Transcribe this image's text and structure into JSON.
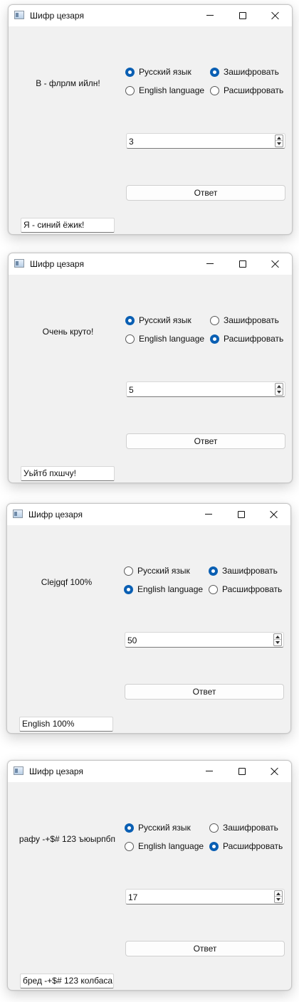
{
  "windows": [
    {
      "title": "Шифр цезаря",
      "output": "В - флрлм ийлн!",
      "lang_options": [
        {
          "label": "Русский язык",
          "selected": true
        },
        {
          "label": "English language",
          "selected": false
        }
      ],
      "mode_options": [
        {
          "label": "Зашифровать",
          "selected": true
        },
        {
          "label": "Расшифровать",
          "selected": false
        }
      ],
      "shift": "3",
      "answer_button": "Ответ",
      "input": "Я - синий ёжик!"
    },
    {
      "title": "Шифр цезаря",
      "output": "Очень круто!",
      "lang_options": [
        {
          "label": "Русский язык",
          "selected": true
        },
        {
          "label": "English language",
          "selected": false
        }
      ],
      "mode_options": [
        {
          "label": "Зашифровать",
          "selected": false
        },
        {
          "label": "Расшифровать",
          "selected": true
        }
      ],
      "shift": "5",
      "answer_button": "Ответ",
      "input": "Уьйтб пхшчу!"
    },
    {
      "title": "Шифр цезаря",
      "output": "Clejgqf 100%",
      "lang_options": [
        {
          "label": "Русский язык",
          "selected": false
        },
        {
          "label": "English language",
          "selected": true
        }
      ],
      "mode_options": [
        {
          "label": "Зашифровать",
          "selected": true
        },
        {
          "label": "Расшифровать",
          "selected": false
        }
      ],
      "shift": "50",
      "answer_button": "Ответ",
      "input": "English 100%"
    },
    {
      "title": "Шифр цезаря",
      "output": "рафу -+$# 123 ъюырпбп",
      "lang_options": [
        {
          "label": "Русский язык",
          "selected": true
        },
        {
          "label": "English language",
          "selected": false
        }
      ],
      "mode_options": [
        {
          "label": "Зашифровать",
          "selected": false
        },
        {
          "label": "Расшифровать",
          "selected": true
        }
      ],
      "shift": "17",
      "answer_button": "Ответ",
      "input": "бред -+$# 123 колбаса"
    }
  ],
  "icons": {
    "app": "app-window-icon",
    "minimize": "minimize-icon",
    "maximize": "maximize-icon",
    "close": "close-icon"
  },
  "colors": {
    "window_bg": "#f1f1f1",
    "titlebar_bg": "#ffffff",
    "radio_selected": "#0a5fb3"
  }
}
